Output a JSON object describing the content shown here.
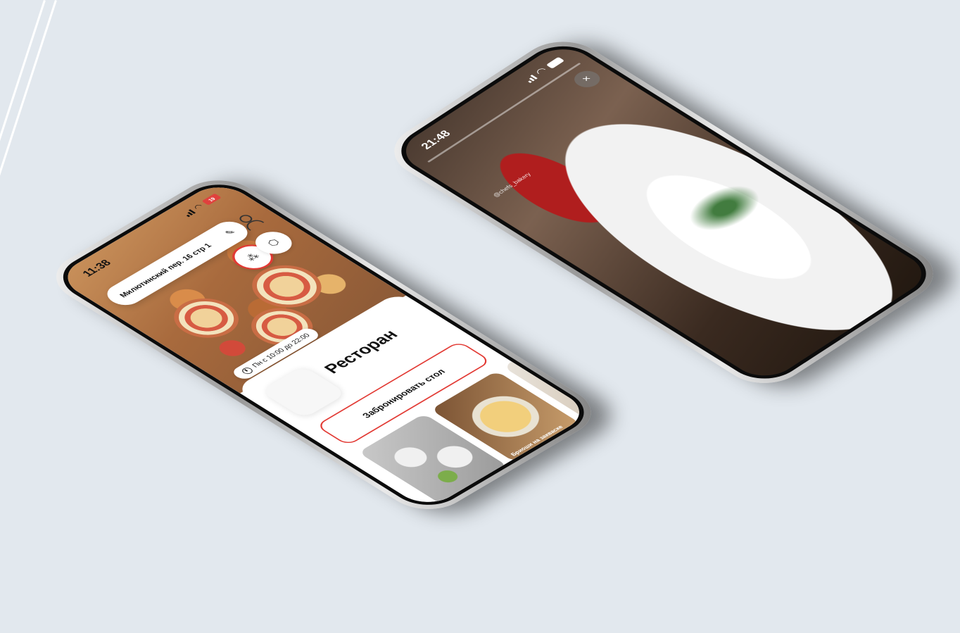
{
  "phone_left": {
    "status": {
      "time": "11:38",
      "battery": "19"
    },
    "address": "Милютинский пер. 16 стр 1",
    "hours": "Пн с 10:00 до 22:00",
    "restaurant_title": "Ресторан",
    "book_button": "Забронировать стол",
    "thumbnails": [
      {
        "caption": ""
      },
      {
        "caption": "Бриоши на закваске"
      },
      {
        "caption": ""
      }
    ]
  },
  "phone_right": {
    "status": {
      "time": "21:48"
    },
    "close_label": "×",
    "credit": "@chefs_bakery"
  },
  "colors": {
    "accent": "#e23a34",
    "background": "#e2e8ee"
  }
}
